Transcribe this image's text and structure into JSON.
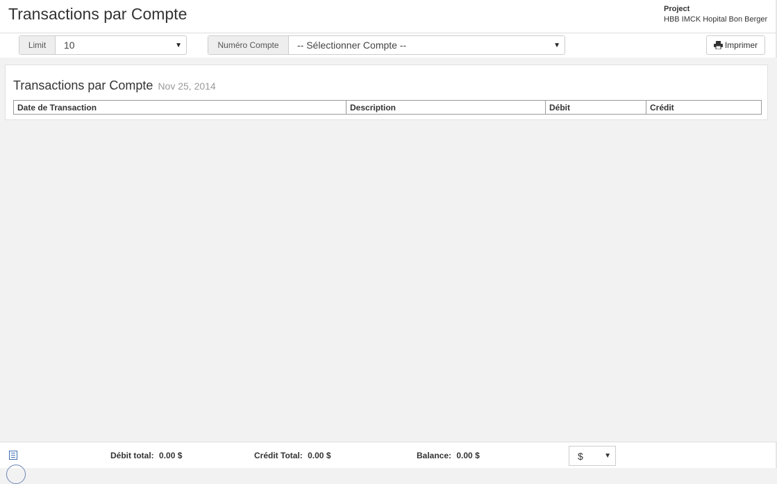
{
  "header": {
    "title": "Transactions par Compte",
    "project_label": "Project",
    "project_name": "HBB IMCK Hopital Bon Berger"
  },
  "toolbar": {
    "limit_label": "Limit",
    "limit_value": "10",
    "account_label": "Numéro Compte",
    "account_value": "-- Sélectionner Compte --",
    "print_label": "Imprimer"
  },
  "report": {
    "title": "Transactions par Compte",
    "date": "Nov 25, 2014",
    "columns": [
      "Date de Transaction",
      "Description",
      "Débit",
      "Crédit"
    ]
  },
  "footer": {
    "debit_label": "Débit total:",
    "debit_value": "0.00 $",
    "credit_label": "Crédit Total:",
    "credit_value": "0.00 $",
    "balance_label": "Balance:",
    "balance_value": "0.00 $",
    "currency_value": "$"
  },
  "icons": {
    "caret": "caret-down-icon",
    "print": "print-icon",
    "list": "list-icon"
  }
}
